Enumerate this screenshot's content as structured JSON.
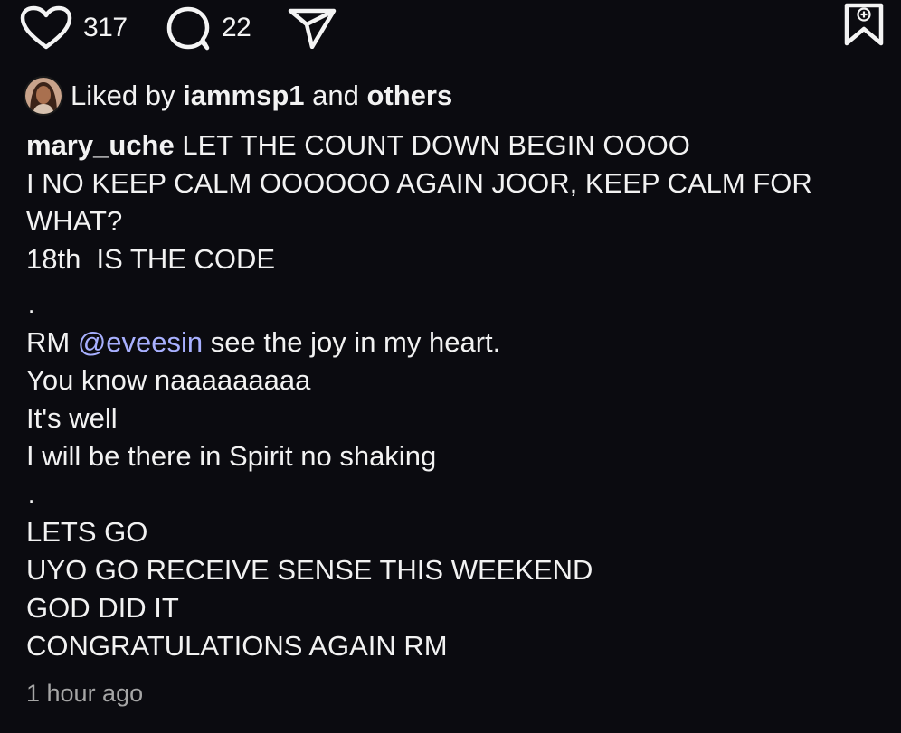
{
  "actions": {
    "like_count": "317",
    "comment_count": "22",
    "icons": [
      "heart-icon",
      "comment-icon",
      "send-icon",
      "save-bookmark-icon"
    ]
  },
  "likes": {
    "prefix": "Liked by",
    "user": "iammsp1",
    "and": "and",
    "others": "others"
  },
  "caption": {
    "username": "mary_uche",
    "first_line": " LET THE COUNT DOWN BEGIN OOOO",
    "line2": "I NO KEEP CALM OOOOOO AGAIN JOOR, KEEP CALM FOR",
    "line3": "WHAT?",
    "line4": "18th  IS THE CODE",
    "dot1": ".",
    "rm_prefix": "RM ",
    "mention": "@eveesin",
    "rm_suffix": " see the joy in my heart.",
    "line6": "You know naaaaaaaaa",
    "line7": "It's well",
    "line8": "I will be there in Spirit no shaking",
    "dot2": ".",
    "line9": "LETS GO",
    "line10": "UYO GO RECEIVE SENSE THIS WEEKEND",
    "line11": "GOD DID IT",
    "line12": "CONGRATULATIONS AGAIN RM"
  },
  "timestamp": "1 hour ago"
}
